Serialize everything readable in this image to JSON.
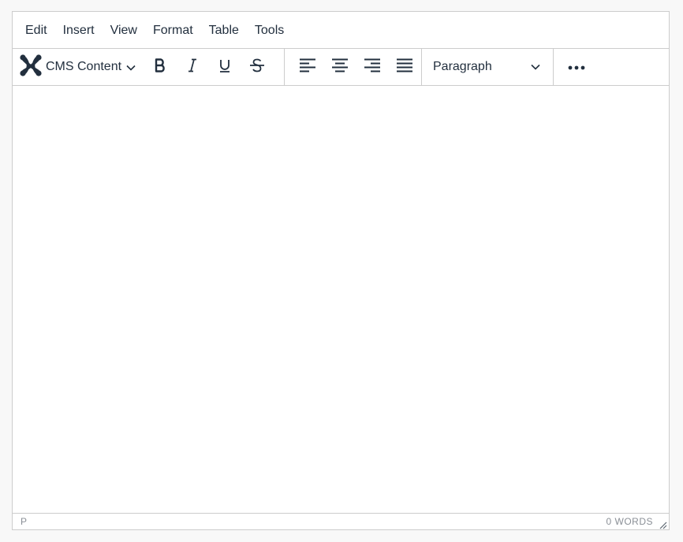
{
  "menubar": {
    "items": [
      "Edit",
      "Insert",
      "View",
      "Format",
      "Table",
      "Tools"
    ]
  },
  "toolbar": {
    "cms_label": "CMS Content",
    "buttons": {
      "bold": "bold-icon",
      "italic": "italic-icon",
      "underline": "underline-icon",
      "strikethrough": "strikethrough-icon",
      "align_left": "align-left-icon",
      "align_center": "align-center-icon",
      "align_right": "align-right-icon",
      "justify": "align-justify-icon",
      "more": "more-horizontal-icon"
    },
    "block_format": "Paragraph"
  },
  "statusbar": {
    "path": "P",
    "word_count": "0 WORDS"
  },
  "colors": {
    "icon": "#222f3e",
    "border": "#cccccc",
    "status_text": "#8a8f96"
  }
}
